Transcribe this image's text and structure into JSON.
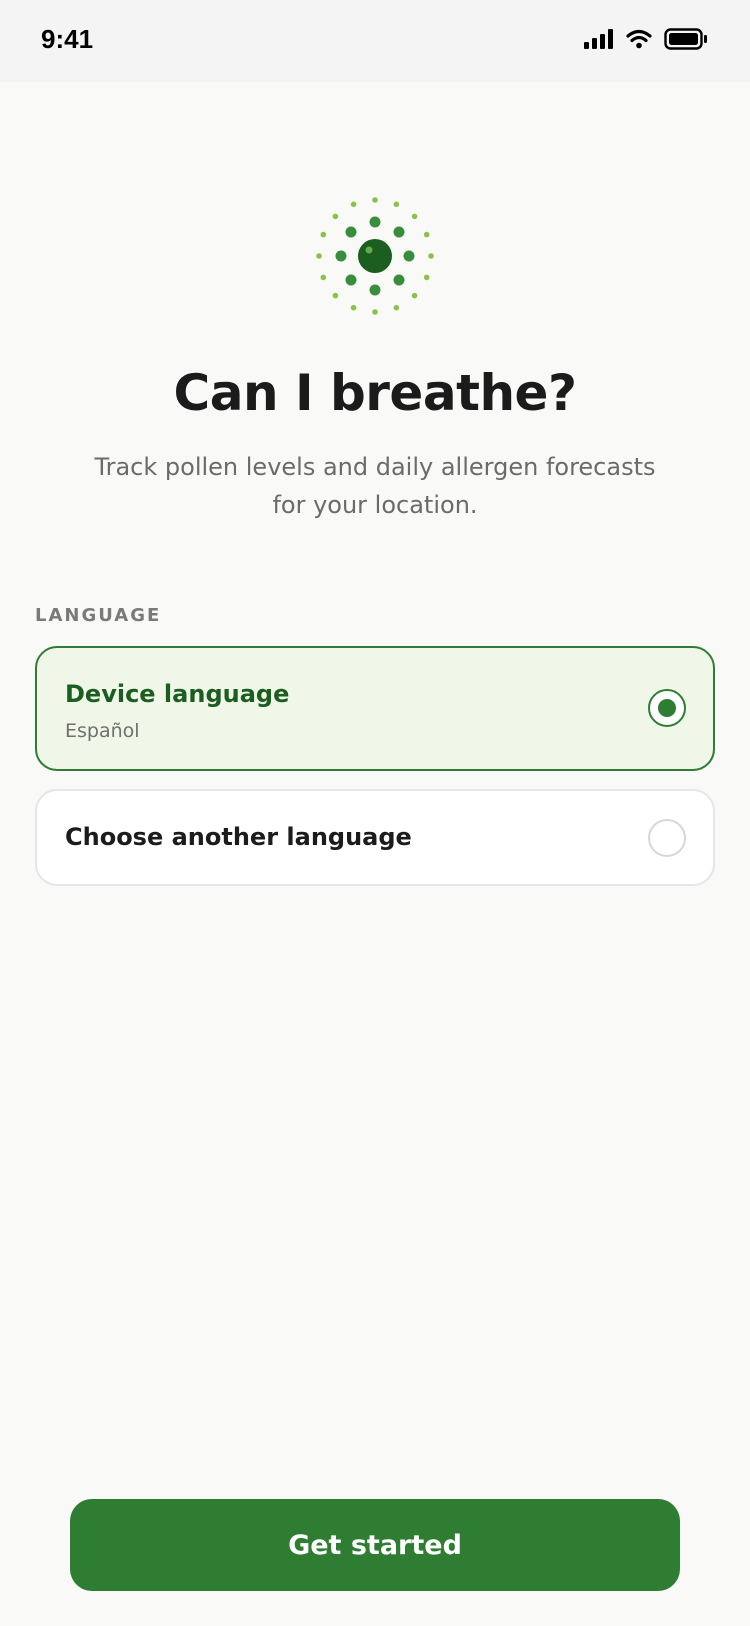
{
  "status_bar": {
    "time": "9:41",
    "icons": [
      "cellular-signal-icon",
      "wifi-icon",
      "battery-icon"
    ]
  },
  "app": {
    "logo_icon": "pollen-logo-icon",
    "title": "Can I breathe?",
    "subtitle": "Track pollen levels and daily allergen forecasts for your location."
  },
  "language": {
    "section_label": "LANGUAGE",
    "options": [
      {
        "title": "Device language",
        "subtitle": "Español",
        "selected": true
      },
      {
        "title": "Choose another language",
        "selected": false
      }
    ]
  },
  "footer": {
    "cta_label": "Get started"
  },
  "colors": {
    "accent": "#2e7d32",
    "accent_dark": "#1b5e20",
    "accent_light": "#8bc34a",
    "selected_bg": "#f0f6e8",
    "background": "#f9f9f7"
  }
}
